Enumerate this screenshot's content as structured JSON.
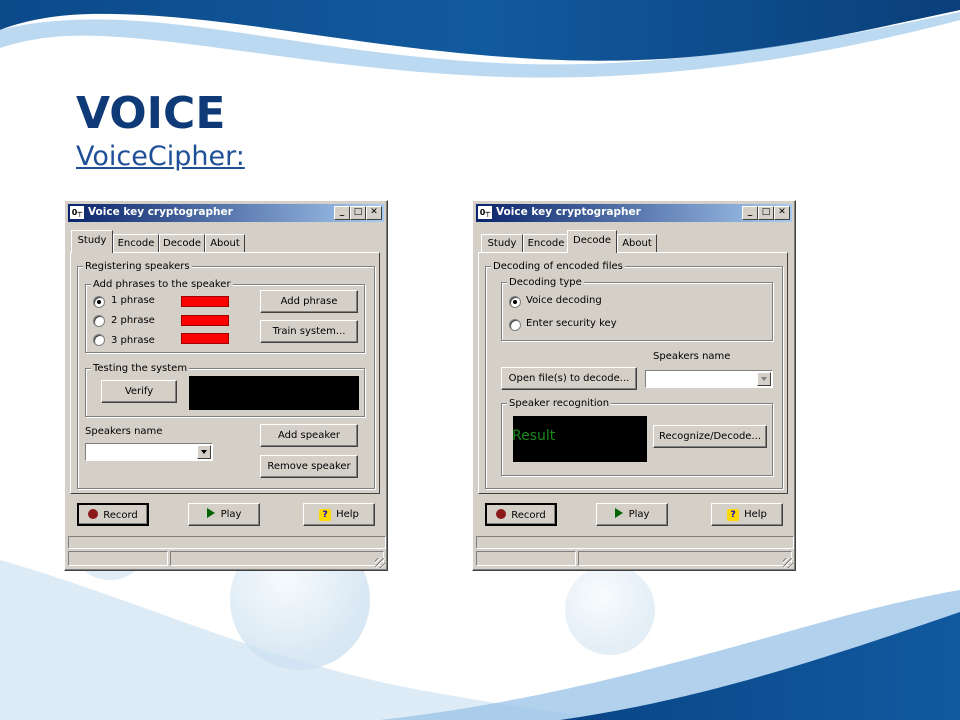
{
  "slide": {
    "title": "VOICE",
    "subtitle": "VoiceCipher:",
    "colors": {
      "title": "#0f3a78",
      "wave_dark": "#0f4d8c",
      "wave_light": "#7fb0dc"
    }
  },
  "window_left": {
    "title": "Voice key cryptographer",
    "app_icon": "key-icon",
    "tabs": [
      {
        "label": "Study",
        "active": true
      },
      {
        "label": "Encode",
        "active": false
      },
      {
        "label": "Decode",
        "active": false
      },
      {
        "label": "About",
        "active": false
      }
    ],
    "study": {
      "registering_group": "Registering speakers",
      "add_phrases_group": "Add phrases to the speaker",
      "phrases": [
        {
          "label": "1 phrase",
          "selected": true
        },
        {
          "label": "2 phrase",
          "selected": false
        },
        {
          "label": "3 phrase",
          "selected": false
        }
      ],
      "add_phrase_button": "Add phrase",
      "train_button": "Train system...",
      "testing_group": "Testing the system",
      "verify_button": "Verify",
      "speakers_name_label": "Speakers name",
      "speakers_name_value": "",
      "add_speaker_button": "Add speaker",
      "remove_speaker_button": "Remove speaker"
    },
    "bottom": {
      "record": "Record",
      "play": "Play",
      "help": "Help"
    }
  },
  "window_right": {
    "title": "Voice key cryptographer",
    "app_icon": "key-icon",
    "tabs": [
      {
        "label": "Study",
        "active": false
      },
      {
        "label": "Encode",
        "active": false
      },
      {
        "label": "Decode",
        "active": true
      },
      {
        "label": "About",
        "active": false
      }
    ],
    "decode": {
      "decoding_group": "Decoding of encoded files",
      "type_group": "Decoding type",
      "options": [
        {
          "label": "Voice decoding",
          "selected": true
        },
        {
          "label": "Enter security key",
          "selected": false
        }
      ],
      "speakers_name_label": "Speakers name",
      "speakers_name_value": "",
      "open_files_button": "Open file(s) to decode...",
      "recognition_group": "Speaker recognition",
      "result_text": "Result",
      "result_color": "#1a8a1a",
      "recognize_button": "Recognize/Decode..."
    },
    "bottom": {
      "record": "Record",
      "play": "Play",
      "help": "Help"
    }
  }
}
